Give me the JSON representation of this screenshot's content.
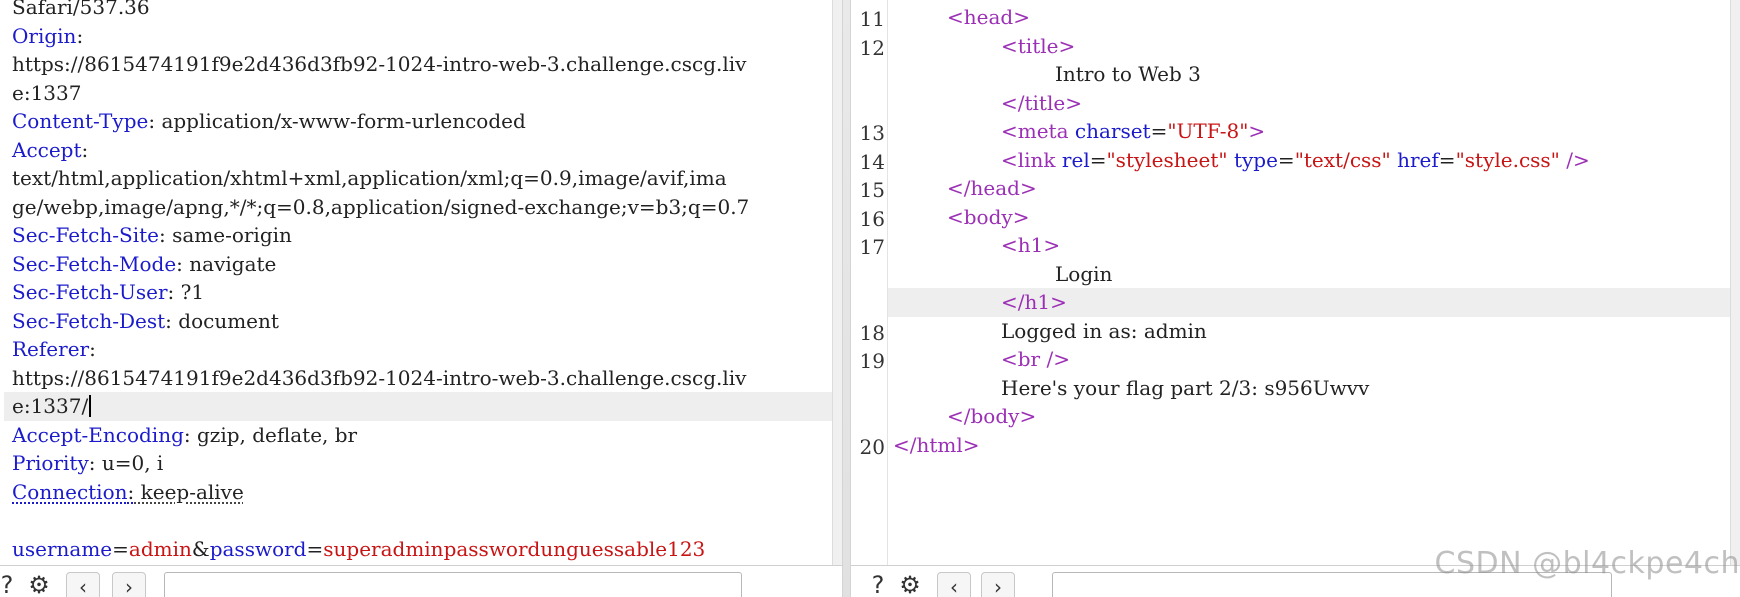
{
  "request_pane": {
    "lines": [
      {
        "type": "plain",
        "text": "Safari/537.36"
      },
      {
        "type": "header",
        "name": "Origin",
        "value": ""
      },
      {
        "type": "plain",
        "text": "https://8615474191f9e2d436d3fb92-1024-intro-web-3.challenge.cscg.liv"
      },
      {
        "type": "plain",
        "text": "e:1337"
      },
      {
        "type": "header",
        "name": "Content-Type",
        "value": "application/x-www-form-urlencoded"
      },
      {
        "type": "header",
        "name": "Accept",
        "value": ""
      },
      {
        "type": "plain",
        "text": "text/html,application/xhtml+xml,application/xml;q=0.9,image/avif,ima"
      },
      {
        "type": "plain",
        "text": "ge/webp,image/apng,*/*;q=0.8,application/signed-exchange;v=b3;q=0.7"
      },
      {
        "type": "header",
        "name": "Sec-Fetch-Site",
        "value": "same-origin"
      },
      {
        "type": "header",
        "name": "Sec-Fetch-Mode",
        "value": "navigate"
      },
      {
        "type": "header",
        "name": "Sec-Fetch-User",
        "value": "?1"
      },
      {
        "type": "header",
        "name": "Sec-Fetch-Dest",
        "value": "document"
      },
      {
        "type": "header",
        "name": "Referer",
        "value": ""
      },
      {
        "type": "plain",
        "text": "https://8615474191f9e2d436d3fb92-1024-intro-web-3.challenge.cscg.liv"
      },
      {
        "type": "plain",
        "text": "e:1337/",
        "highlight": true,
        "caret": true
      },
      {
        "type": "header",
        "name": "Accept-Encoding",
        "value": "gzip, deflate, br"
      },
      {
        "type": "header",
        "name": "Priority",
        "value": "u=0, i"
      },
      {
        "type": "header",
        "name": "Connection",
        "value": "keep-alive",
        "dotted": true
      },
      {
        "type": "blank"
      },
      {
        "type": "body",
        "params": [
          {
            "name": "username",
            "value": "admin"
          },
          {
            "name": "password",
            "value": "superadminpasswordunguessable123"
          }
        ]
      }
    ]
  },
  "response_pane": {
    "lines": [
      {
        "num": "11",
        "indent": 1,
        "tokens": [
          {
            "t": "tag",
            "s": "<head>"
          }
        ]
      },
      {
        "num": "12",
        "indent": 2,
        "tokens": [
          {
            "t": "tag",
            "s": "<title>"
          }
        ]
      },
      {
        "num": "",
        "indent": 3,
        "tokens": [
          {
            "t": "txt",
            "s": "Intro to Web 3"
          }
        ]
      },
      {
        "num": "",
        "indent": 2,
        "tokens": [
          {
            "t": "tag",
            "s": "</title>"
          }
        ]
      },
      {
        "num": "13",
        "indent": 2,
        "tokens": [
          {
            "t": "tag",
            "s": "<meta "
          },
          {
            "t": "attr",
            "s": "charset"
          },
          {
            "t": "txt",
            "s": "="
          },
          {
            "t": "str",
            "s": "\"UTF-8\""
          },
          {
            "t": "tag",
            "s": ">"
          }
        ]
      },
      {
        "num": "14",
        "indent": 2,
        "tokens": [
          {
            "t": "tag",
            "s": "<link "
          },
          {
            "t": "attr",
            "s": "rel"
          },
          {
            "t": "txt",
            "s": "="
          },
          {
            "t": "str",
            "s": "\"stylesheet\""
          },
          {
            "t": "txt",
            "s": " "
          },
          {
            "t": "attr",
            "s": "type"
          },
          {
            "t": "txt",
            "s": "="
          },
          {
            "t": "str",
            "s": "\"text/css\""
          },
          {
            "t": "txt",
            "s": " "
          },
          {
            "t": "attr",
            "s": "href"
          },
          {
            "t": "txt",
            "s": "="
          },
          {
            "t": "str",
            "s": "\"style.css\""
          },
          {
            "t": "tag",
            "s": " />"
          }
        ]
      },
      {
        "num": "15",
        "indent": 1,
        "tokens": [
          {
            "t": "tag",
            "s": "</head>"
          }
        ]
      },
      {
        "num": "16",
        "indent": 1,
        "tokens": [
          {
            "t": "tag",
            "s": "<body>"
          }
        ]
      },
      {
        "num": "17",
        "indent": 2,
        "tokens": [
          {
            "t": "tag",
            "s": "<h1>"
          }
        ]
      },
      {
        "num": "",
        "indent": 3,
        "tokens": [
          {
            "t": "txt",
            "s": "Login"
          }
        ]
      },
      {
        "num": "",
        "indent": 2,
        "highlight": true,
        "tokens": [
          {
            "t": "tag",
            "s": "</h1>"
          }
        ]
      },
      {
        "num": "18",
        "indent": 2,
        "tokens": [
          {
            "t": "txt",
            "s": "Logged in as: admin"
          }
        ]
      },
      {
        "num": "19",
        "indent": 2,
        "tokens": [
          {
            "t": "tag",
            "s": "<br />"
          }
        ]
      },
      {
        "num": "",
        "indent": 2,
        "tokens": [
          {
            "t": "txt",
            "s": "Here's your flag part 2/3: s956Uwvv"
          }
        ]
      },
      {
        "num": "",
        "indent": 1,
        "tokens": [
          {
            "t": "tag",
            "s": "</body>"
          }
        ]
      },
      {
        "num": "20",
        "indent": 0,
        "tokens": [
          {
            "t": "tag",
            "s": "</html>"
          }
        ]
      }
    ]
  },
  "toolbar": {
    "help_icon": "question-circle-icon",
    "settings_icon": "gear-icon",
    "back_icon": "chevron-left-icon",
    "forward_icon": "chevron-right-icon"
  },
  "watermark": "CSDN @bl4ckpe4ch"
}
